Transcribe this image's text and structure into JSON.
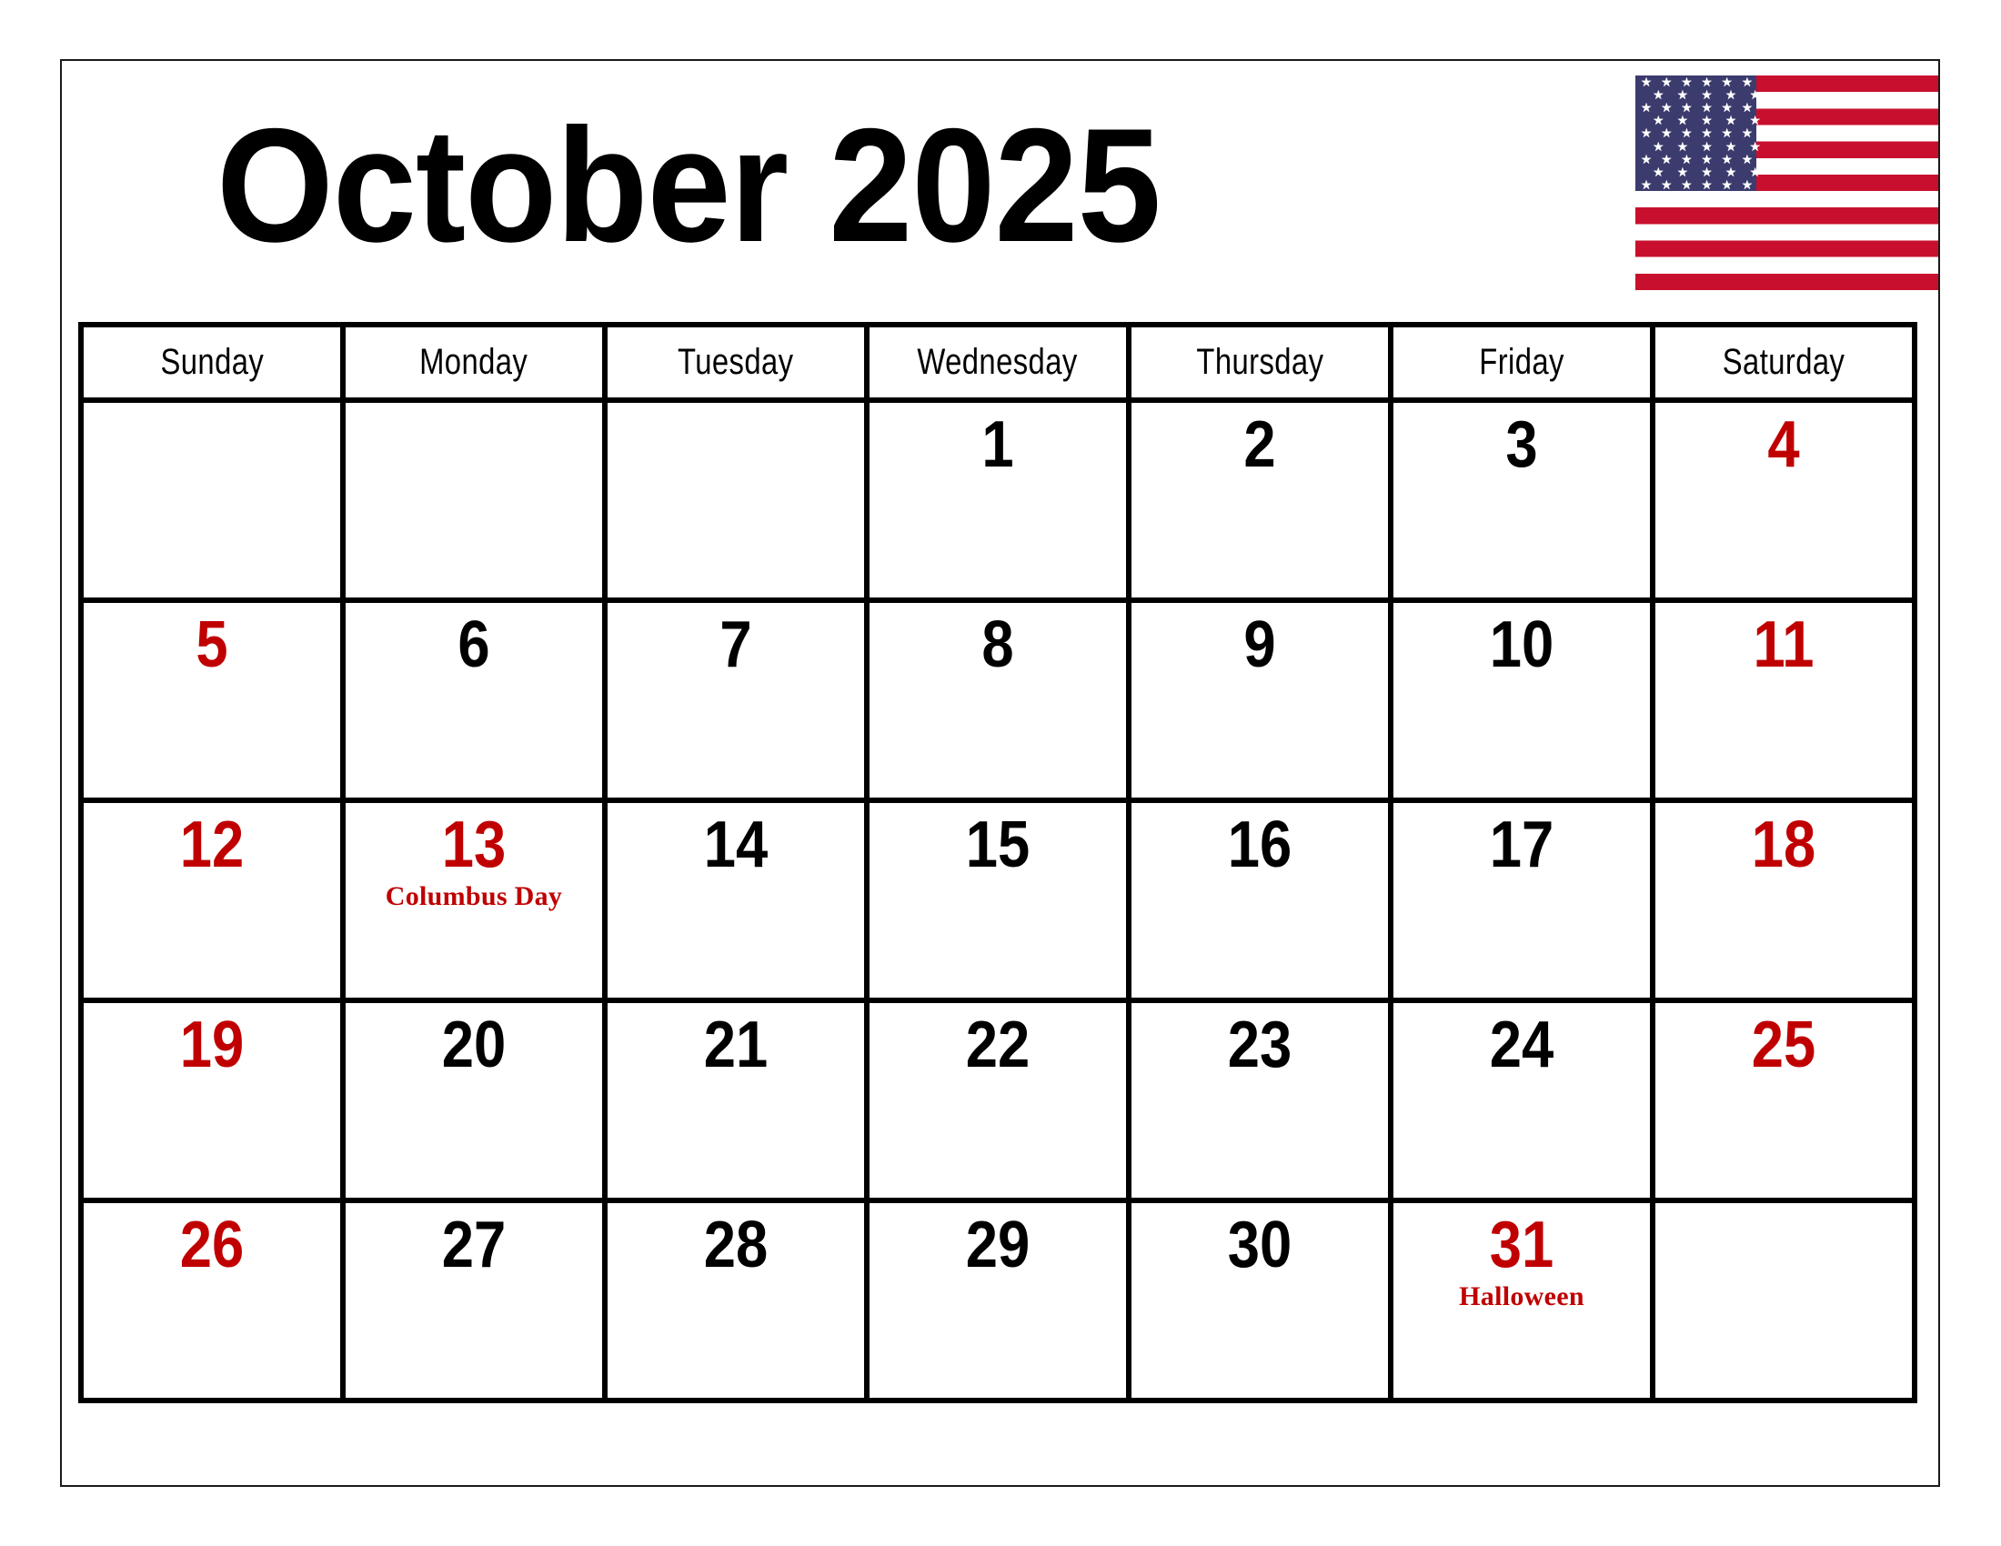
{
  "title": "October 2025",
  "month": "October",
  "year": "2025",
  "colors": {
    "weekend_red": "#C00000",
    "holiday_red": "#C00000",
    "text_black": "#000000",
    "flag_navy": "#3C3B6E",
    "flag_red": "#C8102E",
    "grid_line": "#000000"
  },
  "flag": {
    "name": "united-states-flag",
    "stripes": 13,
    "star_rows": [
      6,
      5,
      6,
      5,
      6,
      5,
      6,
      5,
      6
    ],
    "star_glyph": "★"
  },
  "weekdays": [
    "Sunday",
    "Monday",
    "Tuesday",
    "Wednesday",
    "Thursday",
    "Friday",
    "Saturday"
  ],
  "weeks": [
    [
      {
        "day": "",
        "event": "",
        "weekend": false,
        "holiday": false,
        "empty": true
      },
      {
        "day": "",
        "event": "",
        "weekend": false,
        "holiday": false,
        "empty": true
      },
      {
        "day": "",
        "event": "",
        "weekend": false,
        "holiday": false,
        "empty": true
      },
      {
        "day": "1",
        "event": "",
        "weekend": false,
        "holiday": false,
        "empty": false
      },
      {
        "day": "2",
        "event": "",
        "weekend": false,
        "holiday": false,
        "empty": false
      },
      {
        "day": "3",
        "event": "",
        "weekend": false,
        "holiday": false,
        "empty": false
      },
      {
        "day": "4",
        "event": "",
        "weekend": true,
        "holiday": false,
        "empty": false
      }
    ],
    [
      {
        "day": "5",
        "event": "",
        "weekend": true,
        "holiday": false,
        "empty": false
      },
      {
        "day": "6",
        "event": "",
        "weekend": false,
        "holiday": false,
        "empty": false
      },
      {
        "day": "7",
        "event": "",
        "weekend": false,
        "holiday": false,
        "empty": false
      },
      {
        "day": "8",
        "event": "",
        "weekend": false,
        "holiday": false,
        "empty": false
      },
      {
        "day": "9",
        "event": "",
        "weekend": false,
        "holiday": false,
        "empty": false
      },
      {
        "day": "10",
        "event": "",
        "weekend": false,
        "holiday": false,
        "empty": false
      },
      {
        "day": "11",
        "event": "",
        "weekend": true,
        "holiday": false,
        "empty": false
      }
    ],
    [
      {
        "day": "12",
        "event": "",
        "weekend": true,
        "holiday": false,
        "empty": false
      },
      {
        "day": "13",
        "event": "Columbus Day",
        "weekend": false,
        "holiday": true,
        "empty": false
      },
      {
        "day": "14",
        "event": "",
        "weekend": false,
        "holiday": false,
        "empty": false
      },
      {
        "day": "15",
        "event": "",
        "weekend": false,
        "holiday": false,
        "empty": false
      },
      {
        "day": "16",
        "event": "",
        "weekend": false,
        "holiday": false,
        "empty": false
      },
      {
        "day": "17",
        "event": "",
        "weekend": false,
        "holiday": false,
        "empty": false
      },
      {
        "day": "18",
        "event": "",
        "weekend": true,
        "holiday": false,
        "empty": false
      }
    ],
    [
      {
        "day": "19",
        "event": "",
        "weekend": true,
        "holiday": false,
        "empty": false
      },
      {
        "day": "20",
        "event": "",
        "weekend": false,
        "holiday": false,
        "empty": false
      },
      {
        "day": "21",
        "event": "",
        "weekend": false,
        "holiday": false,
        "empty": false
      },
      {
        "day": "22",
        "event": "",
        "weekend": false,
        "holiday": false,
        "empty": false
      },
      {
        "day": "23",
        "event": "",
        "weekend": false,
        "holiday": false,
        "empty": false
      },
      {
        "day": "24",
        "event": "",
        "weekend": false,
        "holiday": false,
        "empty": false
      },
      {
        "day": "25",
        "event": "",
        "weekend": true,
        "holiday": false,
        "empty": false
      }
    ],
    [
      {
        "day": "26",
        "event": "",
        "weekend": true,
        "holiday": false,
        "empty": false
      },
      {
        "day": "27",
        "event": "",
        "weekend": false,
        "holiday": false,
        "empty": false
      },
      {
        "day": "28",
        "event": "",
        "weekend": false,
        "holiday": false,
        "empty": false
      },
      {
        "day": "29",
        "event": "",
        "weekend": false,
        "holiday": false,
        "empty": false
      },
      {
        "day": "30",
        "event": "",
        "weekend": false,
        "holiday": false,
        "empty": false
      },
      {
        "day": "31",
        "event": "Halloween",
        "weekend": false,
        "holiday": true,
        "empty": false
      },
      {
        "day": "",
        "event": "",
        "weekend": false,
        "holiday": false,
        "empty": true
      }
    ]
  ],
  "holidays": [
    {
      "date": "13",
      "name": "Columbus Day"
    },
    {
      "date": "31",
      "name": "Halloween"
    }
  ]
}
